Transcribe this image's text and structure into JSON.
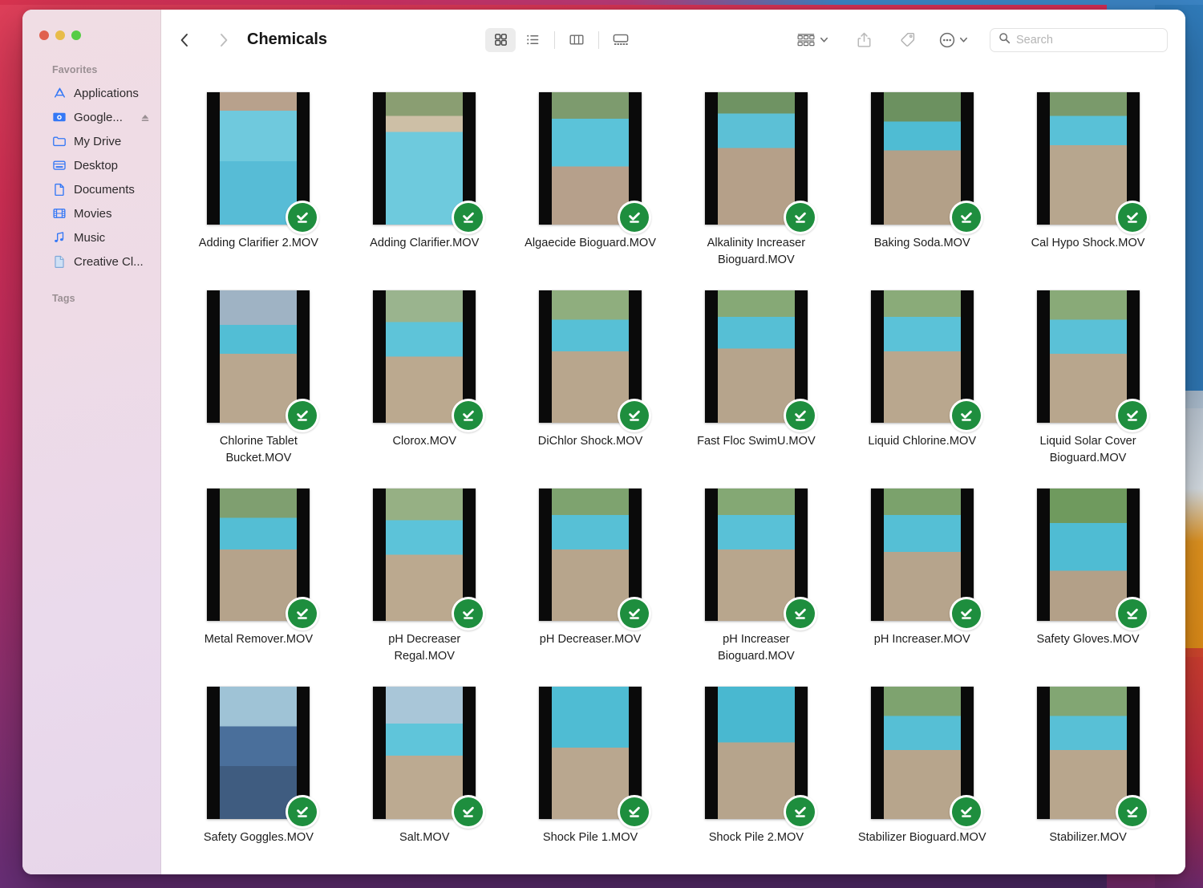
{
  "window": {
    "title": "Chemicals",
    "traffic_lights": [
      "close-button",
      "minimize-button",
      "zoom-button"
    ]
  },
  "sidebar": {
    "sections": [
      {
        "title": "Favorites",
        "items": [
          {
            "label": "Applications",
            "icon": "applications-icon",
            "eject": false
          },
          {
            "label": "Google...",
            "icon": "google-drive-folder-icon",
            "eject": true
          },
          {
            "label": "My Drive",
            "icon": "folder-icon",
            "eject": false
          },
          {
            "label": "Desktop",
            "icon": "desktop-icon",
            "eject": false
          },
          {
            "label": "Documents",
            "icon": "document-icon",
            "eject": false
          },
          {
            "label": "Movies",
            "icon": "movies-icon",
            "eject": false
          },
          {
            "label": "Music",
            "icon": "music-note-icon",
            "eject": false
          },
          {
            "label": "Creative Cl...",
            "icon": "creative-cloud-file-icon",
            "eject": false
          }
        ]
      },
      {
        "title": "Tags",
        "items": []
      }
    ]
  },
  "toolbar": {
    "back_label": "Back",
    "forward_label": "Forward",
    "view_buttons": [
      {
        "name": "icon-view",
        "label": "Icon View",
        "active": true
      },
      {
        "name": "list-view",
        "label": "List View",
        "active": false
      },
      {
        "name": "column-view",
        "label": "Column View",
        "active": false
      },
      {
        "name": "gallery-view",
        "label": "Gallery View",
        "active": false
      }
    ],
    "group_label": "Group",
    "share_label": "Share",
    "tag_label": "Tags",
    "more_label": "More"
  },
  "search": {
    "placeholder": "Search",
    "value": ""
  },
  "colors": {
    "badge_green": "#1e8e3e",
    "accent_blue": "#3478f6",
    "sidebar_pink": "#eedbe6",
    "traffic_red": "#e0604e",
    "traffic_yellow": "#e8bc4a",
    "traffic_green": "#56cc45"
  },
  "files": [
    {
      "name": "Adding Clarifier 2.MOV",
      "badge": "available-offline",
      "thumb": "pool-clarifier-bottle-hand"
    },
    {
      "name": "Adding Clarifier.MOV",
      "badge": "available-offline",
      "thumb": "pool-pouring-clarifier"
    },
    {
      "name": "Algaecide Bioguard.MOV",
      "badge": "available-offline",
      "thumb": "algaecide-bottle-poolside"
    },
    {
      "name": "Alkalinity Increaser Bioguard.MOV",
      "badge": "available-offline",
      "thumb": "balance-pak-100-bag"
    },
    {
      "name": "Baking Soda.MOV",
      "badge": "available-offline",
      "thumb": "arm-hammer-baking-soda"
    },
    {
      "name": "Cal Hypo Shock.MOV",
      "badge": "available-offline",
      "thumb": "cal-hypo-shock-bags"
    },
    {
      "name": "Chlorine Tablet Bucket.MOV",
      "badge": "available-offline",
      "thumb": "chlorine-tablet-bucket"
    },
    {
      "name": "Clorox.MOV",
      "badge": "available-offline",
      "thumb": "clorox-bleach-jug"
    },
    {
      "name": "DiChlor Shock.MOV",
      "badge": "available-offline",
      "thumb": "dichlor-shock-packs"
    },
    {
      "name": "Fast Floc SwimU.MOV",
      "badge": "available-offline",
      "thumb": "fast-floc-orange-bottle"
    },
    {
      "name": "Liquid Chlorine.MOV",
      "badge": "available-offline",
      "thumb": "liquid-chlorine-jug"
    },
    {
      "name": "Liquid Solar Cover Bioguard.MOV",
      "badge": "available-offline",
      "thumb": "liquid-solar-cover-bottle"
    },
    {
      "name": "Metal Remover.MOV",
      "badge": "available-offline",
      "thumb": "metal-remover-bottle"
    },
    {
      "name": "pH Decreaser Regal.MOV",
      "badge": "available-offline",
      "thumb": "ph-decreaser-regal-bucket"
    },
    {
      "name": "pH Decreaser.MOV",
      "badge": "available-offline",
      "thumb": "ph-decreaser-bag"
    },
    {
      "name": "pH Increaser Bioguard.MOV",
      "badge": "available-offline",
      "thumb": "ph-increaser-bioguard-bag"
    },
    {
      "name": "pH Increaser.MOV",
      "badge": "available-offline",
      "thumb": "ph-increaser-bag"
    },
    {
      "name": "Safety Gloves.MOV",
      "badge": "available-offline",
      "thumb": "safety-gloves-pool"
    },
    {
      "name": "Safety Goggles.MOV",
      "badge": "available-offline",
      "thumb": "man-wearing-goggles"
    },
    {
      "name": "Salt.MOV",
      "badge": "available-offline",
      "thumb": "pool-salt-bag"
    },
    {
      "name": "Shock Pile 1.MOV",
      "badge": "available-offline",
      "thumb": "shock-pile-poolside-1"
    },
    {
      "name": "Shock Pile 2.MOV",
      "badge": "available-offline",
      "thumb": "shock-pile-poolside-2"
    },
    {
      "name": "Stabilizer Bioguard.MOV",
      "badge": "available-offline",
      "thumb": "stabilizer-bioguard-bag"
    },
    {
      "name": "Stabilizer.MOV",
      "badge": "available-offline",
      "thumb": "stabilizer-bag"
    }
  ]
}
